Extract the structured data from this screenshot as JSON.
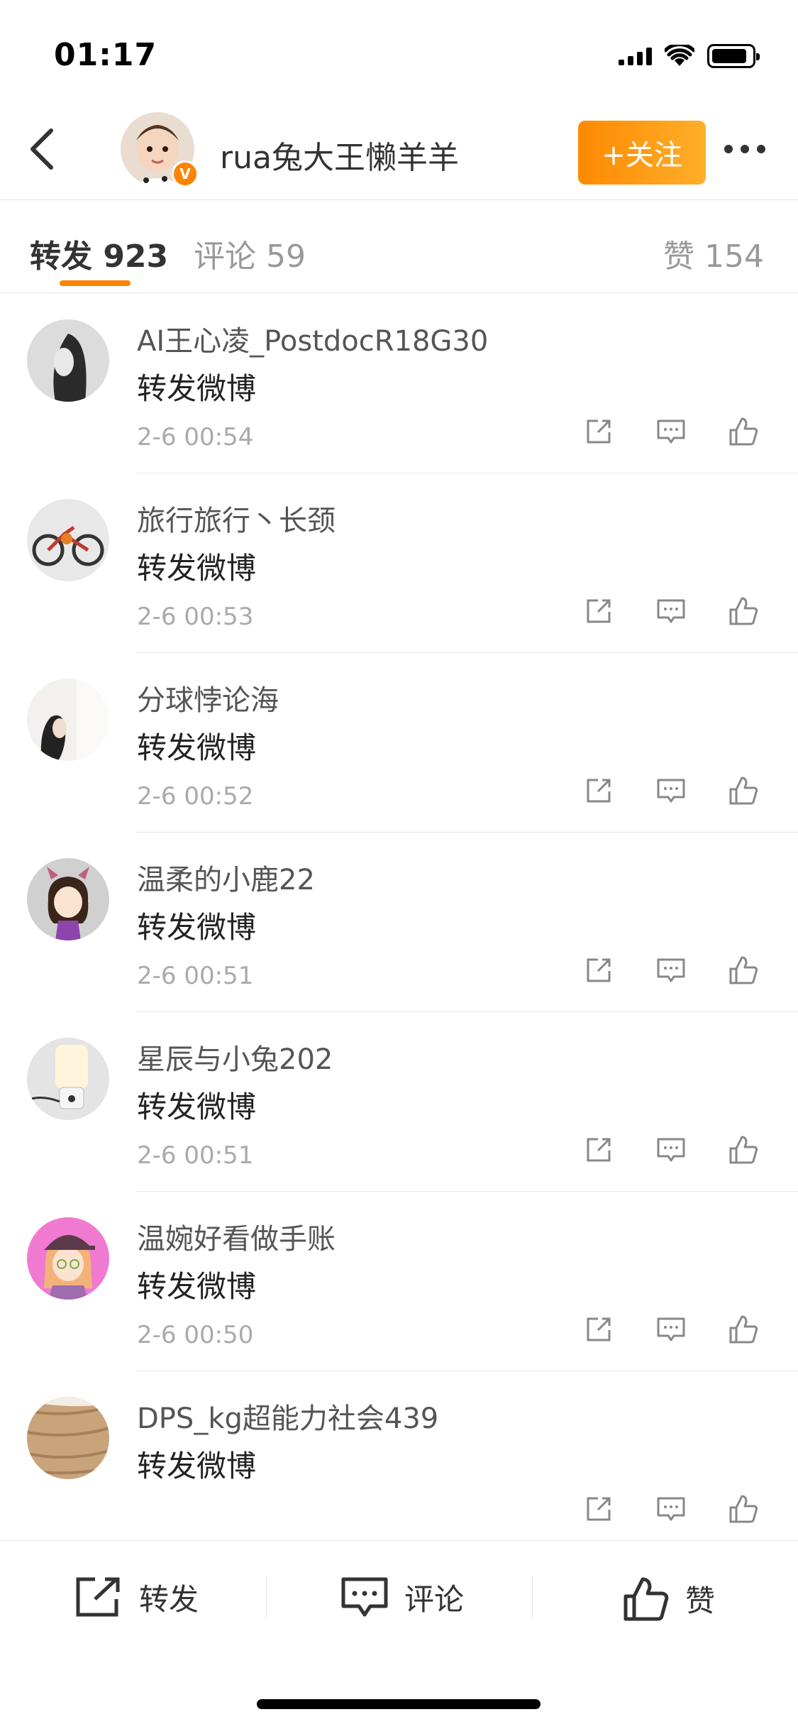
{
  "status_bar": {
    "time": "01:17"
  },
  "header": {
    "user_name": "rua兔大王懒羊羊",
    "verify_badge": "V",
    "follow_label": "+关注"
  },
  "tabs": {
    "repost": "转发 923",
    "comment": "评论 59",
    "like": "赞 154"
  },
  "reposts": [
    {
      "name": "AI王心凌_PostdocR18G30",
      "text": "转发微博",
      "time": "2-6 00:54"
    },
    {
      "name": "旅行旅行丶长颈",
      "text": "转发微博",
      "time": "2-6 00:53"
    },
    {
      "name": "分球悖论海",
      "text": "转发微博",
      "time": "2-6 00:52"
    },
    {
      "name": "温柔的小鹿22",
      "text": "转发微博",
      "time": "2-6 00:51"
    },
    {
      "name": "星辰与小兔202",
      "text": "转发微博",
      "time": "2-6 00:51"
    },
    {
      "name": "温婉好看做手账",
      "text": "转发微博",
      "time": "2-6 00:50"
    },
    {
      "name": "DPS_kg超能力社会439",
      "text": "转发微博",
      "time": ""
    }
  ],
  "bottom_bar": {
    "repost": "转发",
    "comment": "评论",
    "like": "赞"
  }
}
